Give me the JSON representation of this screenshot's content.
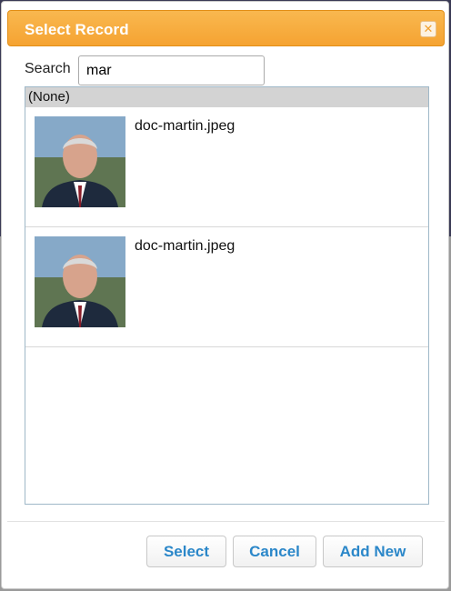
{
  "dialog": {
    "title": "Select Record",
    "close_icon": "close-icon"
  },
  "search": {
    "label": "Search",
    "value": "mar"
  },
  "list": {
    "none_label": "(None)",
    "items": [
      {
        "label": "doc-martin.jpeg",
        "thumbnail": "portrait-photo"
      },
      {
        "label": "doc-martin.jpeg",
        "thumbnail": "portrait-photo"
      }
    ]
  },
  "buttons": {
    "select": "Select",
    "cancel": "Cancel",
    "add_new": "Add New"
  },
  "colors": {
    "titlebar": "#f6a93b",
    "button_text": "#2b87c9"
  }
}
